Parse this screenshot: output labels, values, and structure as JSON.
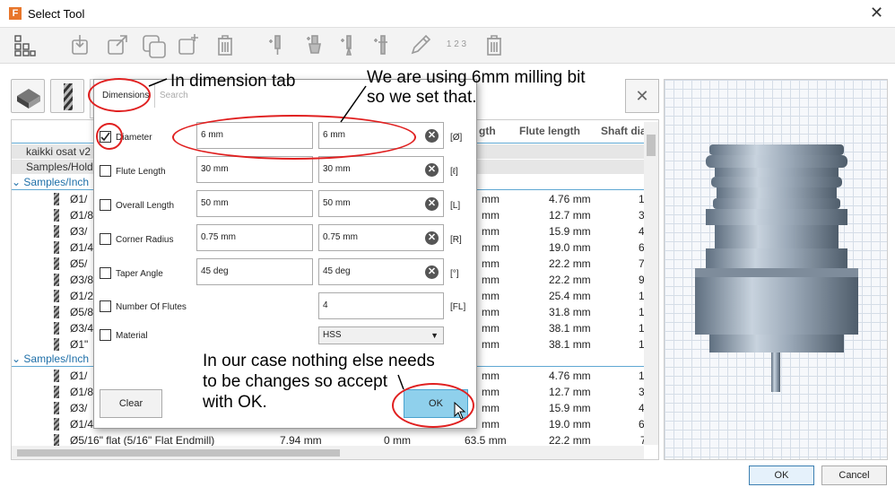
{
  "window": {
    "title": "Select Tool",
    "logo_letter": "F",
    "close_glyph": "✕"
  },
  "toolbar": {
    "icons": [
      "grid-icon",
      "import-icon",
      "export-icon",
      "copy-icon",
      "new-icon",
      "delete-icon",
      "tool-icon-1",
      "tool-icon-2",
      "tool-icon-3",
      "tool-icon-4",
      "pencil-icon",
      "numbering-icon",
      "delete-icon-2"
    ],
    "numbering_label": "1 2 3"
  },
  "search": {
    "close_glyph": "✕"
  },
  "table": {
    "headers": [
      "gth",
      "Flute length",
      "Shaft dia"
    ],
    "library_rows": [
      "kaikki osat v2",
      "Samples/Holders"
    ],
    "group_links": [
      "Samples/Inch",
      "Samples/Inch"
    ],
    "group1": [
      {
        "name": "Ø1/",
        "c1": "mm",
        "c2": "4.76 mm",
        "c3": "1"
      },
      {
        "name": "Ø1/8",
        "c1": "mm",
        "c2": "12.7 mm",
        "c3": "3"
      },
      {
        "name": "Ø3/",
        "c1": "mm",
        "c2": "15.9 mm",
        "c3": "4"
      },
      {
        "name": "Ø1/4",
        "c1": "mm",
        "c2": "19.0 mm",
        "c3": "6"
      },
      {
        "name": "Ø5/",
        "c1": "mm",
        "c2": "22.2 mm",
        "c3": "7"
      },
      {
        "name": "Ø3/8",
        "c1": "mm",
        "c2": "22.2 mm",
        "c3": "9"
      },
      {
        "name": "Ø1/2",
        "c1": "mm",
        "c2": "25.4 mm",
        "c3": "1"
      },
      {
        "name": "Ø5/8",
        "c1": "mm",
        "c2": "31.8 mm",
        "c3": "1"
      },
      {
        "name": "Ø3/4",
        "c1": "mm",
        "c2": "38.1 mm",
        "c3": "1"
      },
      {
        "name": "Ø1\"",
        "c1": "mm",
        "c2": "38.1 mm",
        "c3": "1"
      }
    ],
    "group2": [
      {
        "name": "Ø1/",
        "c1": "mm",
        "c2": "4.76 mm",
        "c3": "1"
      },
      {
        "name": "Ø1/8",
        "c1": "mm",
        "c2": "12.7 mm",
        "c3": "3"
      },
      {
        "name": "Ø3/",
        "c1": "mm",
        "c2": "15.9 mm",
        "c3": "4"
      },
      {
        "name": "Ø1/4",
        "c1": "mm",
        "c2": "19.0 mm",
        "c3": "6"
      }
    ],
    "last_row": {
      "name": "Ø5/16\" flat (5/16\" Flat Endmill)",
      "a": "7.94 mm",
      "b": "0 mm",
      "c": "63.5 mm",
      "d": "22.2 mm",
      "e": "7"
    }
  },
  "dialog": {
    "tabs": {
      "dimensions": "Dimensions",
      "search": "Search"
    },
    "fields": [
      {
        "label": "Diameter",
        "checked": true,
        "min": "6 mm",
        "max": "6 mm",
        "unit": "[Ø]"
      },
      {
        "label": "Flute Length",
        "checked": false,
        "min": "30 mm",
        "max": "30 mm",
        "unit": "[ℓ]"
      },
      {
        "label": "Overall Length",
        "checked": false,
        "min": "50 mm",
        "max": "50 mm",
        "unit": "[L]"
      },
      {
        "label": "Corner Radius",
        "checked": false,
        "min": "0.75 mm",
        "max": "0.75 mm",
        "unit": "[R]"
      },
      {
        "label": "Taper Angle",
        "checked": false,
        "min": "45 deg",
        "max": "45 deg",
        "unit": "[°]"
      }
    ],
    "flutes": {
      "label": "Number Of Flutes",
      "value": "4",
      "unit": "[FL]"
    },
    "material": {
      "label": "Material",
      "value": "HSS"
    },
    "clear_glyph": "✕",
    "clear_button": "Clear",
    "ok_button": "OK"
  },
  "annotations": {
    "tab_note": "In dimension tab",
    "bit_note_1": "We are using 6mm milling bit",
    "bit_note_2": "so we set that.",
    "accept_note_1": "In our case nothing else needs",
    "accept_note_2": "to be changes so accept",
    "accept_note_3": "with OK.",
    "color": "#e02020"
  },
  "footer": {
    "ok": "OK",
    "cancel": "Cancel"
  }
}
